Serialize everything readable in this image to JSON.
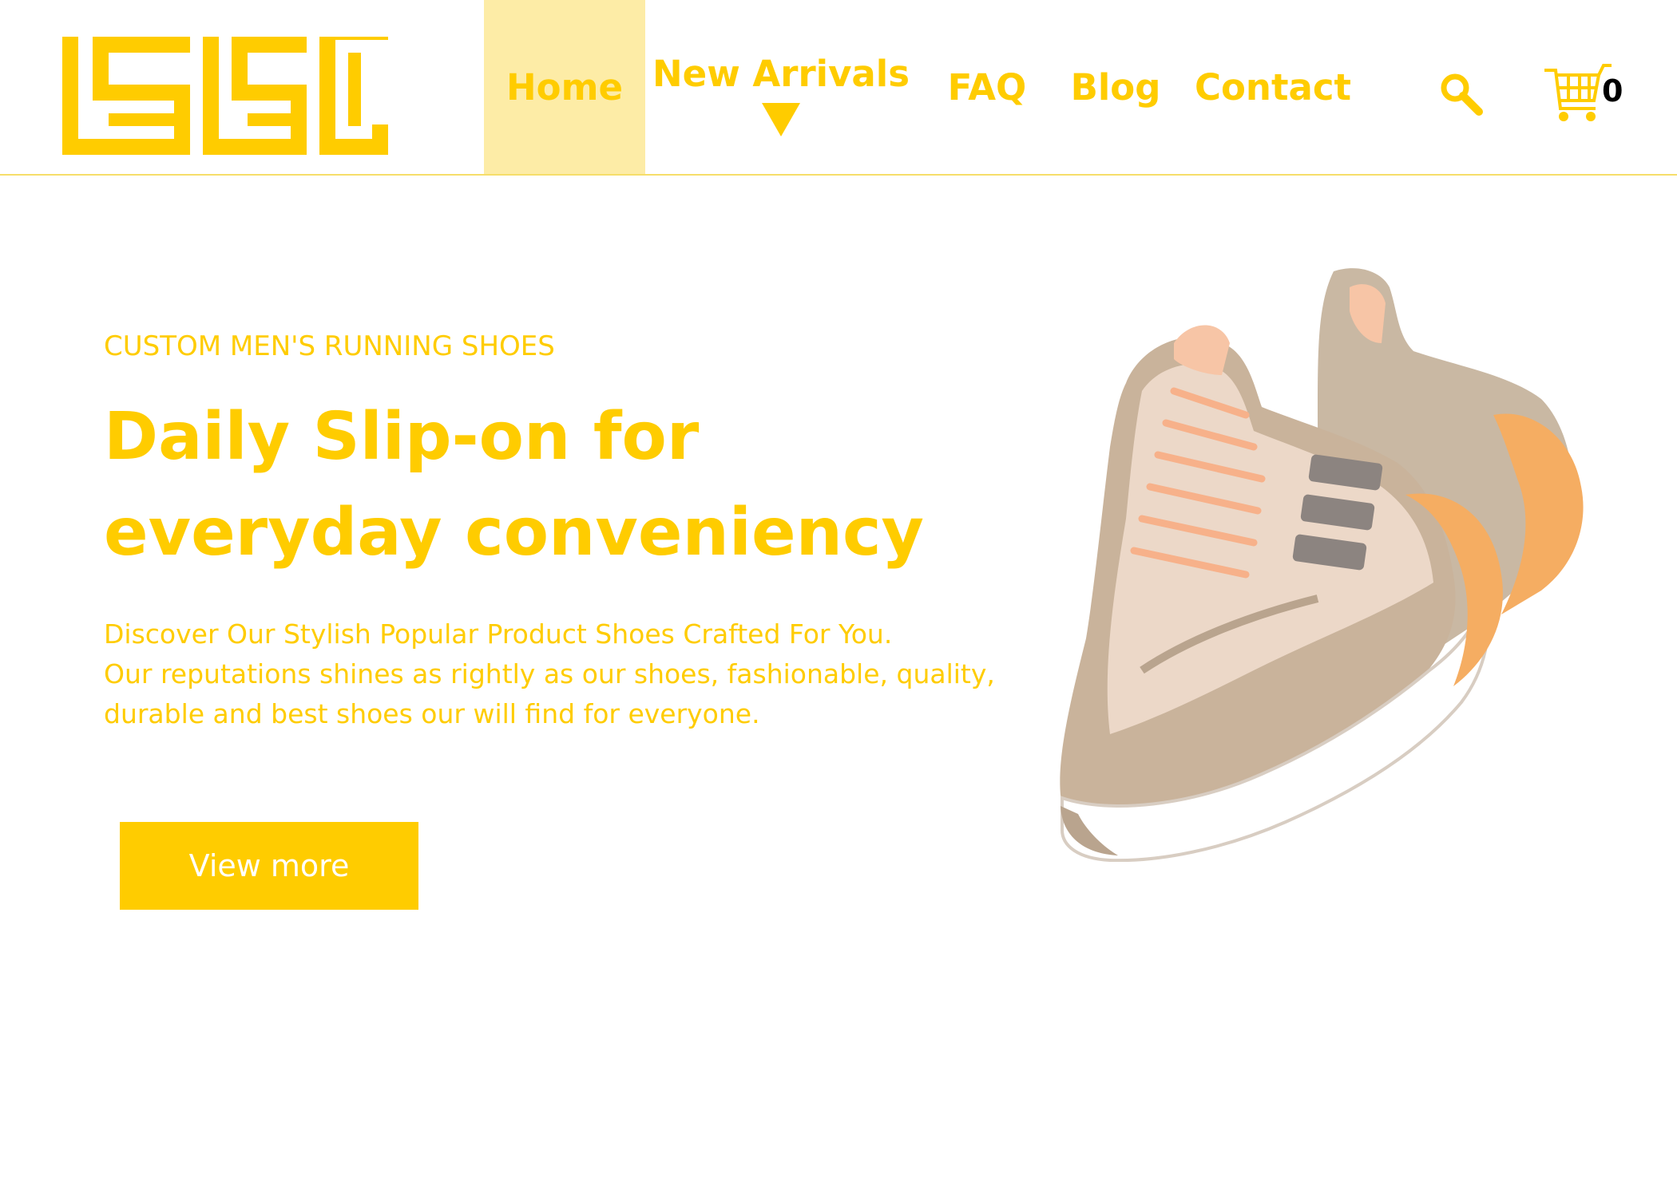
{
  "brand": {
    "logo_icon": "geometric-maze-logo-icon",
    "accent_color": "#ffcc00",
    "light_accent": "#fdeca6"
  },
  "nav": {
    "items": [
      {
        "label": "Home",
        "active": true
      },
      {
        "label": "New Arrivals",
        "has_dropdown": true
      },
      {
        "label": "FAQ"
      },
      {
        "label": "Blog"
      },
      {
        "label": "Contact"
      }
    ],
    "search_icon": "search-icon",
    "cart_icon": "shopping-cart-icon",
    "cart_count": "0"
  },
  "hero": {
    "eyebrow": "CUSTOM MEN'S RUNNING SHOES",
    "headline_line1": "Daily Slip-on for",
    "headline_line2": "everyday conveniency",
    "description_line1": "Discover Our Stylish Popular Product Shoes Crafted For You.",
    "description_line2": "Our reputations shines as rightly as our shoes, fashionable, quality,",
    "description_line3": "durable and best shoes our will find for everyone.",
    "cta_label": "View more",
    "product_image": "running-shoe-image"
  }
}
